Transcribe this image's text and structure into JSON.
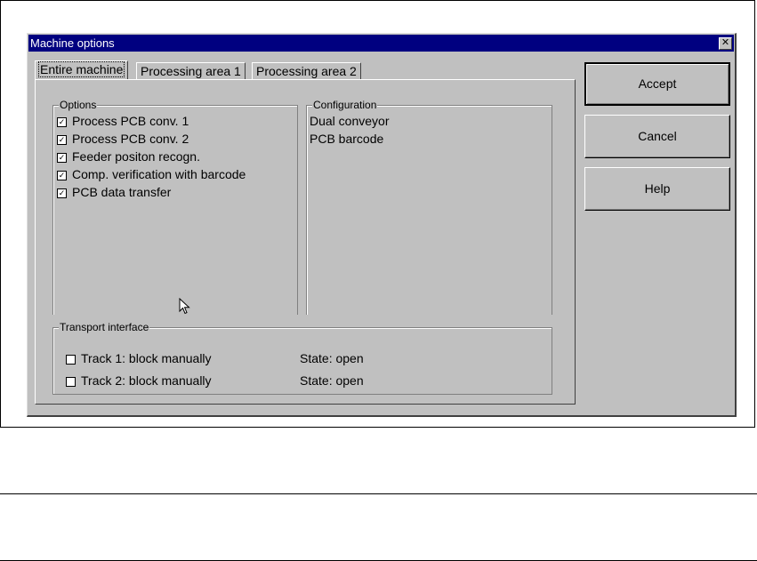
{
  "window": {
    "title": "Machine options",
    "close_glyph": "✕"
  },
  "tabs": [
    {
      "label": "Entire machine",
      "active": true
    },
    {
      "label": "Processing area 1",
      "active": false
    },
    {
      "label": "Processing area 2",
      "active": false
    }
  ],
  "options_group": {
    "legend": "Options",
    "items": [
      {
        "label": "Process PCB conv. 1",
        "checked": true
      },
      {
        "label": "Process PCB conv. 2",
        "checked": true
      },
      {
        "label": "Feeder positon recogn.",
        "checked": true
      },
      {
        "label": "Comp. verification with barcode",
        "checked": true
      },
      {
        "label": "PCB data transfer",
        "checked": true
      }
    ]
  },
  "configuration_group": {
    "legend": "Configuration",
    "items": [
      "Dual conveyor",
      "PCB barcode"
    ]
  },
  "transport_group": {
    "legend": "Transport interface",
    "tracks": [
      {
        "label": "Track 1: block manually",
        "checked": false,
        "state": "State: open"
      },
      {
        "label": "Track 2: block manually",
        "checked": false,
        "state": "State: open"
      }
    ]
  },
  "buttons": {
    "accept": "Accept",
    "cancel": "Cancel",
    "help": "Help"
  },
  "check_glyph": "✓",
  "colors": {
    "titlebar": "#000080",
    "face": "#c0c0c0"
  }
}
